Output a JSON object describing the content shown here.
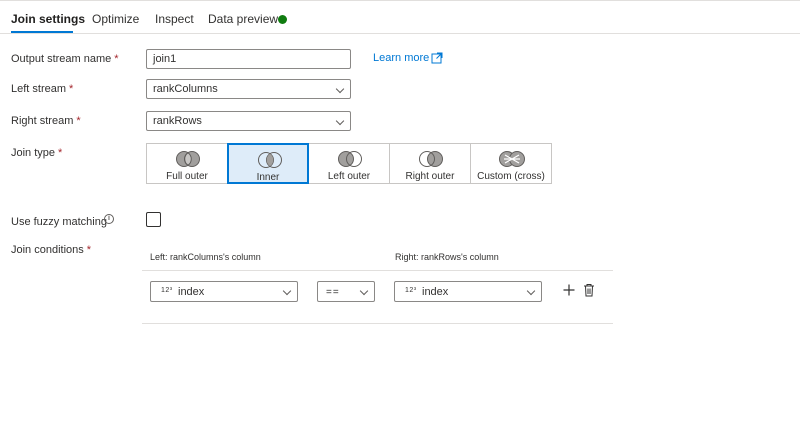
{
  "tabs": [
    {
      "label": "Join settings",
      "active": true
    },
    {
      "label": "Optimize"
    },
    {
      "label": "Inspect"
    },
    {
      "label": "Data preview",
      "status_color": "#107c10"
    }
  ],
  "form": {
    "output_stream_label": "Output stream name",
    "output_stream_value": "join1",
    "learn_more": "Learn more",
    "left_stream_label": "Left stream",
    "left_stream_value": "rankColumns",
    "right_stream_label": "Right stream",
    "right_stream_value": "rankRows",
    "join_type_label": "Join type",
    "join_types": [
      {
        "label": "Full outer",
        "icon": "full-outer-join-icon"
      },
      {
        "label": "Inner",
        "icon": "inner-join-icon",
        "selected": true
      },
      {
        "label": "Left outer",
        "icon": "left-outer-join-icon"
      },
      {
        "label": "Right outer",
        "icon": "right-outer-join-icon"
      },
      {
        "label": "Custom (cross)",
        "icon": "cross-join-icon"
      }
    ],
    "fuzzy_label": "Use fuzzy matching",
    "fuzzy_checked": false,
    "conditions_label": "Join conditions",
    "required_marker": "*"
  },
  "conditions": {
    "left_header": "Left: rankColumns's column",
    "right_header": "Right: rankRows's column",
    "rows": [
      {
        "left_type": "12³",
        "left_column": "index",
        "operator": "==",
        "right_type": "12³",
        "right_column": "index"
      }
    ]
  },
  "colors": {
    "accent": "#0078d4",
    "required": "#a4262c",
    "selected_bg": "#deecf9"
  }
}
